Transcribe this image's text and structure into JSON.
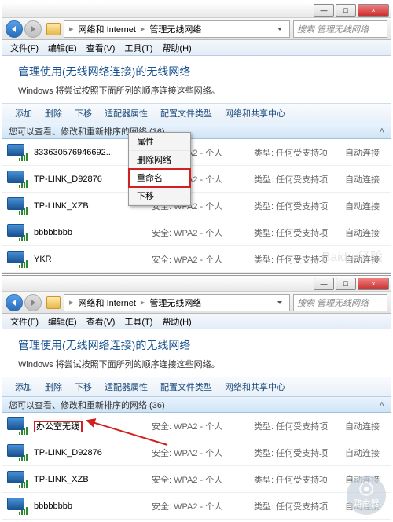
{
  "window": {
    "title": "管理无线网络",
    "min": "—",
    "max": "□",
    "close": "×"
  },
  "breadcrumb": {
    "item1": "网络和 Internet",
    "item2": "管理无线网络",
    "sep": "▸"
  },
  "search": {
    "placeholder": "搜索 管理无线网络"
  },
  "menu": {
    "file": "文件(F)",
    "edit": "编辑(E)",
    "view": "查看(V)",
    "tools": "工具(T)",
    "help": "帮助(H)"
  },
  "header": {
    "title": "管理使用(无线网络连接)的无线网络",
    "desc": "Windows 将尝试按照下面所列的顺序连接这些网络。"
  },
  "toolbar": {
    "add": "添加",
    "remove": "删除",
    "down": "下移",
    "adapter": "适配器属性",
    "profile": "配置文件类型",
    "center": "网络和共享中心"
  },
  "listheader": {
    "text": "您可以查看、修改和重新排序的网络 (36)"
  },
  "columns": {
    "sec_prefix": "安全:",
    "type_prefix": "类型:",
    "sec_wpa2": "WPA2 - 个人",
    "type_any": "任何受支持项",
    "auto": "自动连接"
  },
  "context_menu": {
    "properties": "属性",
    "delete": "删除网络",
    "rename": "重命名",
    "movedown": "下移"
  },
  "networks_top": [
    {
      "name": "333630576946692..."
    },
    {
      "name": "TP-LINK_D92876"
    },
    {
      "name": "TP-LINK_XZB"
    },
    {
      "name": "bbbbbbbb"
    },
    {
      "name": "YKR"
    }
  ],
  "networks_bottom": [
    {
      "name": "办公室无线",
      "renamed": true
    },
    {
      "name": "TP-LINK_D92876"
    },
    {
      "name": "TP-LINK_XZB"
    },
    {
      "name": "bbbbbbbb"
    }
  ],
  "watermark": "Baidu 经验",
  "router_badge": "路由器"
}
